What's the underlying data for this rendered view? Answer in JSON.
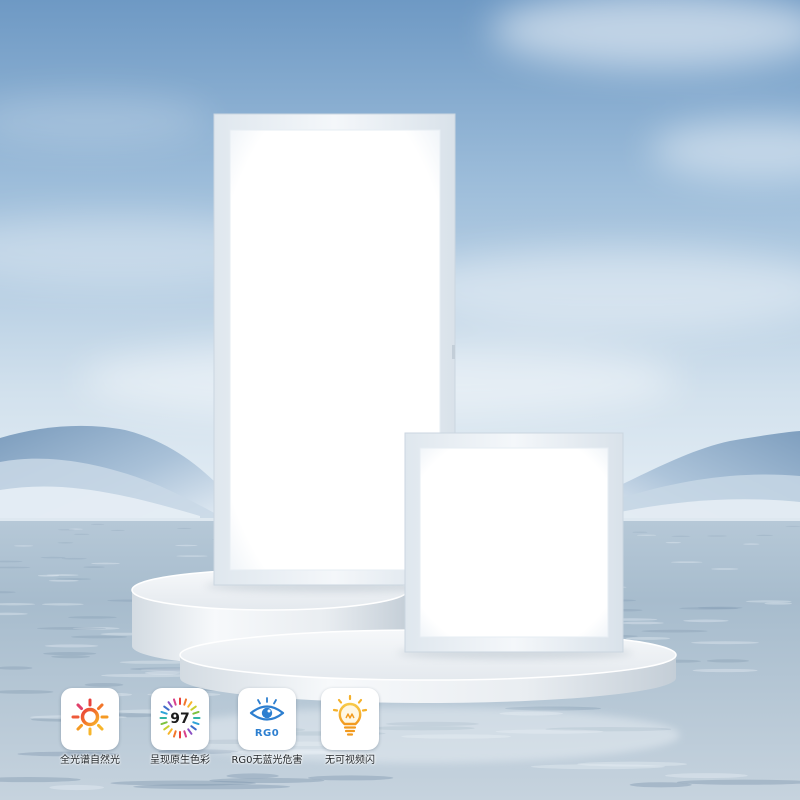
{
  "features": [
    {
      "label": "全光谱自然光",
      "icon": "full-spectrum-sun-icon"
    },
    {
      "label": "呈现原生色彩",
      "icon": "color-rendering-index-icon",
      "icon_text": "97"
    },
    {
      "label": "RG0无蓝光危害",
      "icon": "no-blue-light-hazard-eye-icon",
      "icon_text": "RG0"
    },
    {
      "label": "无可视频闪",
      "icon": "flicker-free-bulb-icon"
    }
  ],
  "colors": {
    "sky_top": "#6e99c4",
    "horizon": "#e6eff6",
    "water": "#a9bfd1",
    "panel_light": "#ffffff",
    "eye_blue": "#2d7fd0",
    "bulb_orange": "#f29a1e",
    "sun_rays": [
      "#e8413c",
      "#f2762a",
      "#f59a23",
      "#f7b52a",
      "#f7b52a",
      "#f59a23",
      "#ee5a3a",
      "#e0406a"
    ],
    "spectrum": [
      "#e8413c",
      "#f2762a",
      "#f7b52a",
      "#c8cf2e",
      "#7cc23f",
      "#2fb3a5",
      "#2fa3d8",
      "#3d6cc9",
      "#8a4fc2",
      "#d9408a"
    ]
  }
}
